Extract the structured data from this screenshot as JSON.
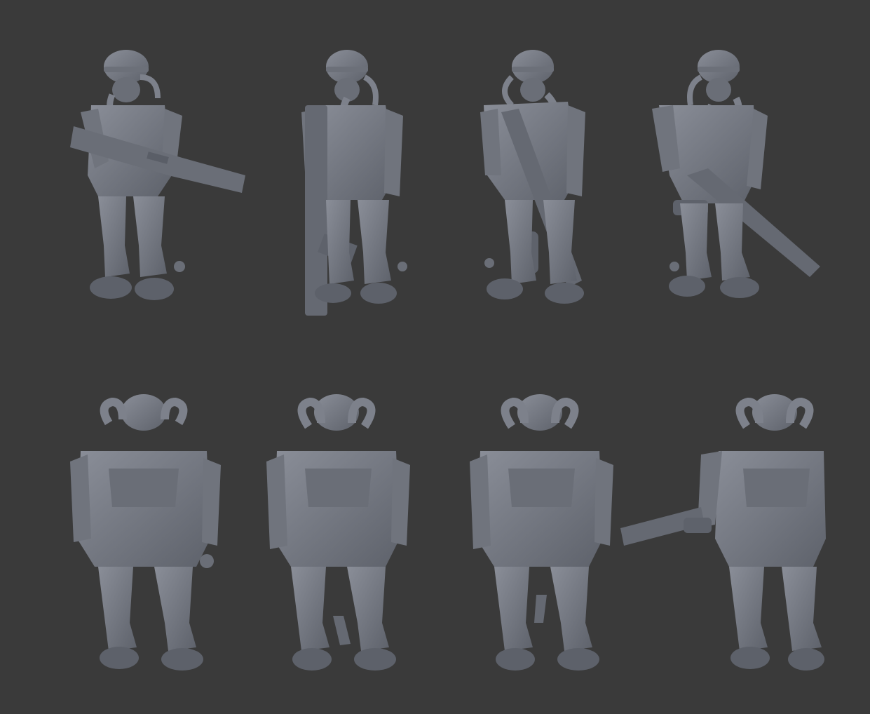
{
  "scene": {
    "background_color": "#3a3a3a",
    "model_color": "#7b7f8a",
    "model_shadow": "#4f535c",
    "model_highlight": "#9a9ea8"
  },
  "rows": [
    {
      "view": "front",
      "figures": [
        {
          "pose": "rifle-held-horizontal"
        },
        {
          "pose": "rifle-held-vertical-left"
        },
        {
          "pose": "rifle-held-diagonal"
        },
        {
          "pose": "rifle-held-low-right"
        }
      ]
    },
    {
      "view": "back",
      "figures": [
        {
          "pose": "back-view-1"
        },
        {
          "pose": "back-view-2"
        },
        {
          "pose": "back-view-3"
        },
        {
          "pose": "back-view-rifle-left"
        }
      ]
    }
  ]
}
